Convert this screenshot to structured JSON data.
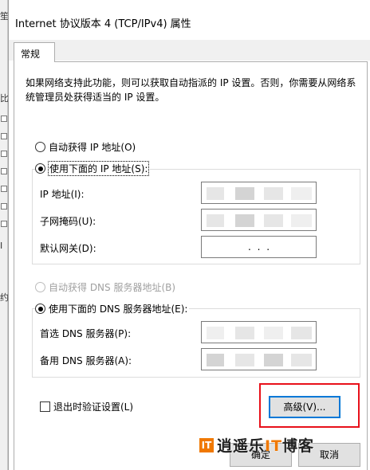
{
  "window": {
    "title": "Internet 协议版本 4 (TCP/IPv4) 属性"
  },
  "tabs": [
    {
      "label": "常规"
    }
  ],
  "general": {
    "description": "如果网络支持此功能，则可以获取自动指派的 IP 设置。否则，你需要从网络系统管理员处获得适当的 IP 设置。",
    "ip": {
      "auto_option": "自动获得 IP 地址(O)",
      "manual_option": "使用下面的 IP 地址(S):",
      "selected": "manual",
      "fields": [
        {
          "label": "IP 地址(I):",
          "value": ""
        },
        {
          "label": "子网掩码(U):",
          "value": ""
        },
        {
          "label": "默认网关(D):",
          "value": ".   .   ."
        }
      ]
    },
    "dns": {
      "auto_option": "自动获得 DNS 服务器地址(B)",
      "manual_option": "使用下面的 DNS 服务器地址(E):",
      "selected": "manual",
      "auto_disabled": true,
      "fields": [
        {
          "label": "首选 DNS 服务器(P):",
          "value": ""
        },
        {
          "label": "备用 DNS 服务器(A):",
          "value": ""
        }
      ]
    },
    "validate_on_exit": {
      "label": "退出时验证设置(L)",
      "checked": false
    },
    "advanced_button": "高级(V)..."
  },
  "footer": {
    "ok_button": "确定",
    "cancel_button": "取消"
  },
  "annotation": {
    "highlight_color": "#e8101a"
  },
  "background_window": {
    "fragments": [
      "笙",
      "比",
      "I",
      "约"
    ]
  },
  "watermark": {
    "logo": "IT",
    "text_main": "逍遥乐",
    "text_accent": "IT",
    "text_tail": "博客"
  }
}
